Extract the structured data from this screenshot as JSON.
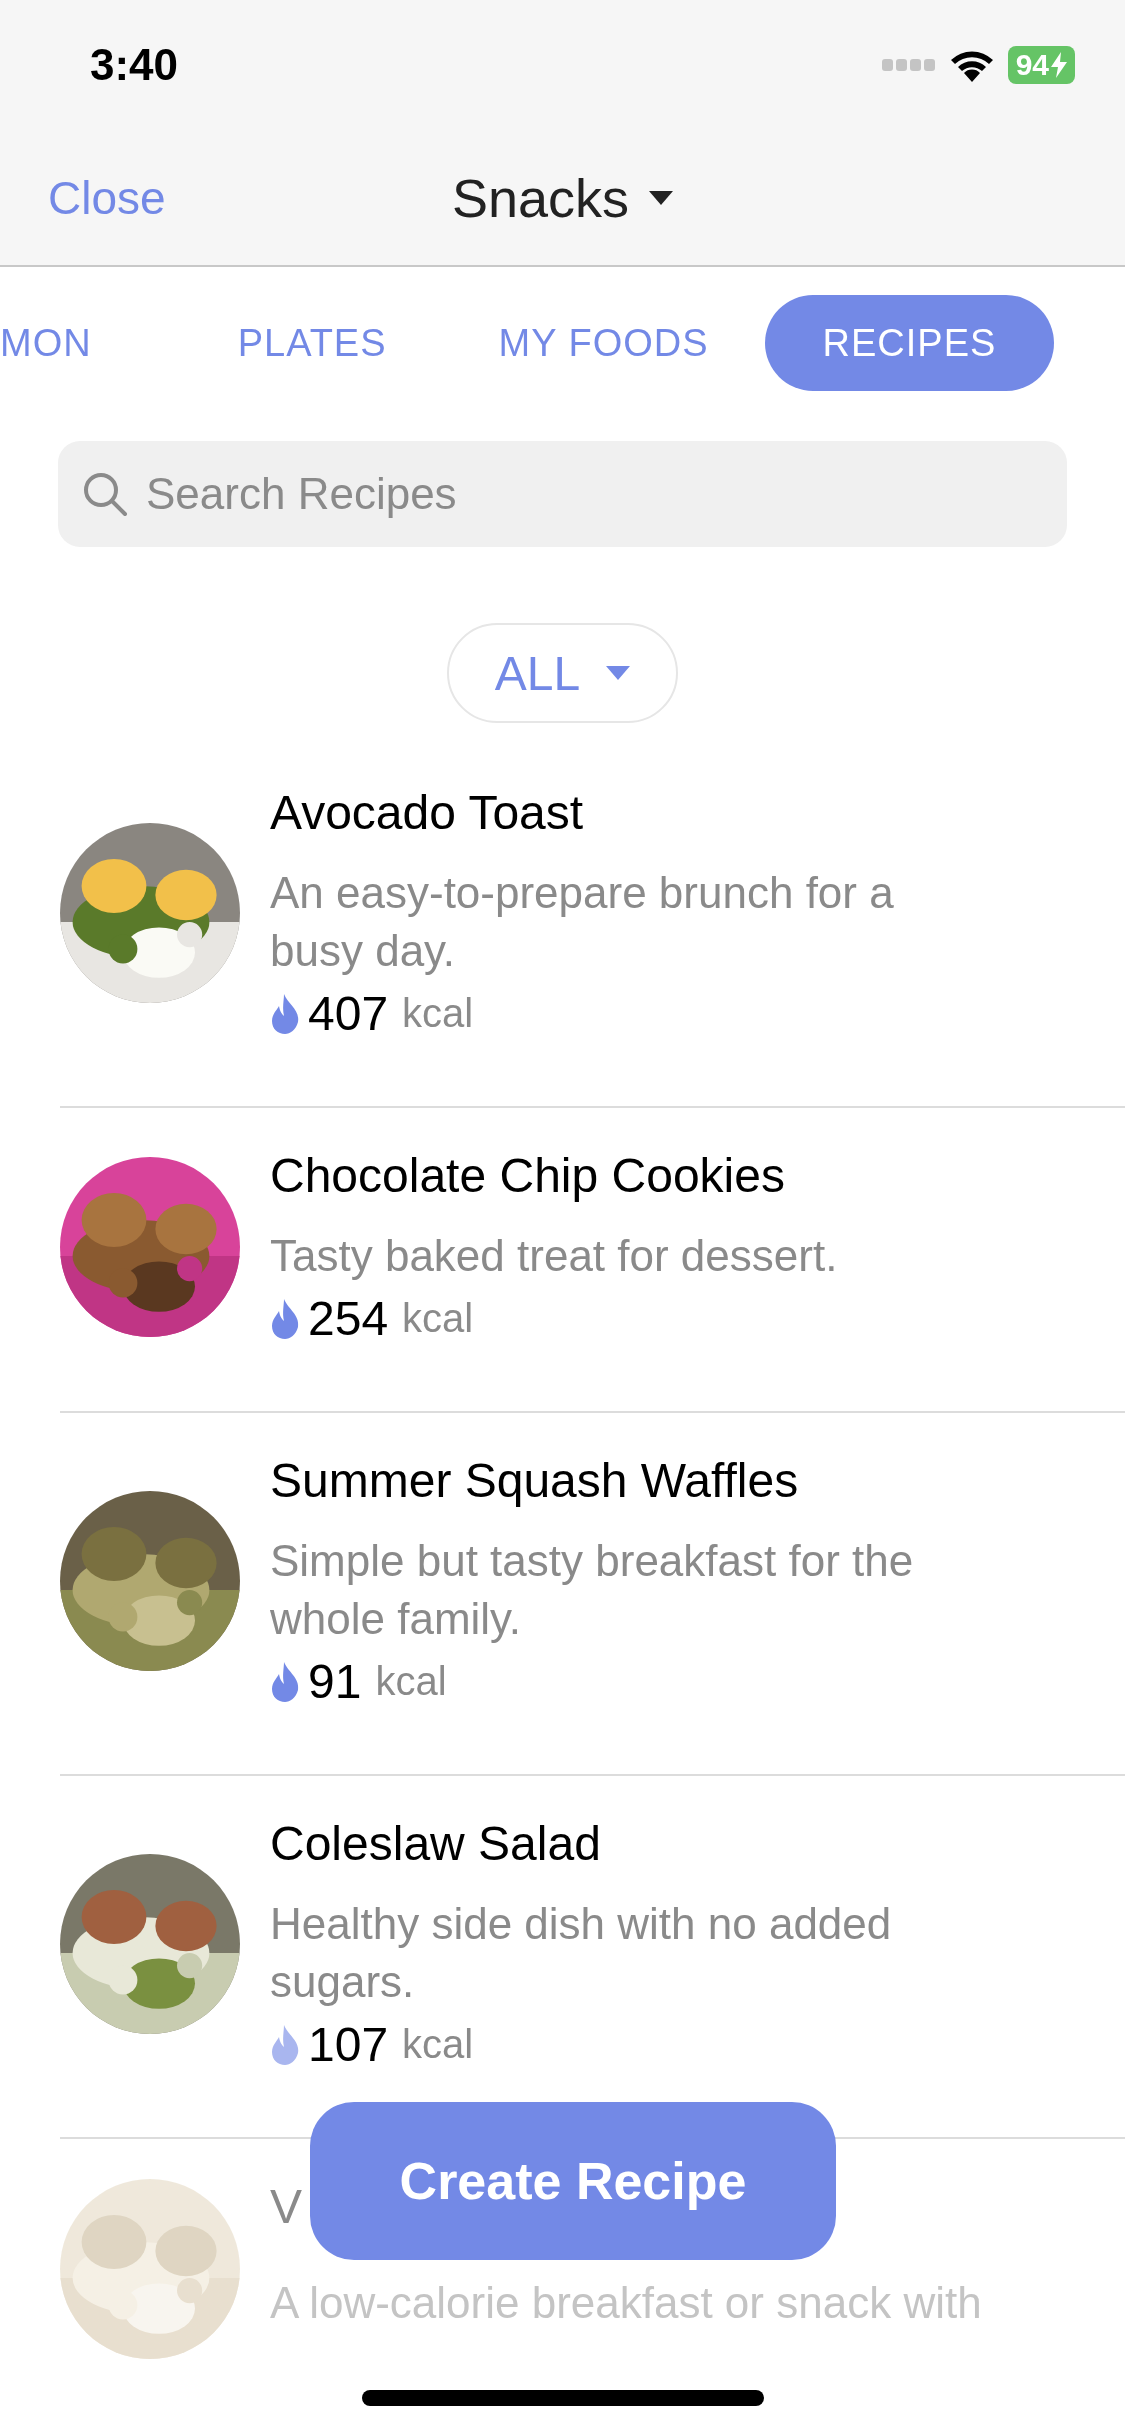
{
  "status_bar": {
    "time": "3:40",
    "battery": "94"
  },
  "nav": {
    "close": "Close",
    "title": "Snacks"
  },
  "tabs": [
    {
      "label": "MON",
      "selected": false
    },
    {
      "label": "PLATES",
      "selected": false
    },
    {
      "label": "MY FOODS",
      "selected": false
    },
    {
      "label": "RECIPES",
      "selected": true
    }
  ],
  "search": {
    "placeholder": "Search Recipes"
  },
  "filter": {
    "label": "ALL"
  },
  "recipes": [
    {
      "title": "Avocado Toast",
      "description": "An easy-to-prepare brunch for a busy day.",
      "kcal": "407",
      "unit": "kcal"
    },
    {
      "title": "Chocolate Chip Cookies",
      "description": "Tasty baked treat for dessert.",
      "kcal": "254",
      "unit": "kcal"
    },
    {
      "title": "Summer Squash Waffles",
      "description": "Simple but tasty breakfast for the whole family.",
      "kcal": "91",
      "unit": "kcal"
    },
    {
      "title": "Coleslaw Salad",
      "description": "Healthy side dish with no added sugars.",
      "kcal": "107",
      "unit": "kcal"
    },
    {
      "title": "V",
      "description": "A low-calorie breakfast or snack with"
    }
  ],
  "create_button": {
    "label": "Create Recipe"
  }
}
